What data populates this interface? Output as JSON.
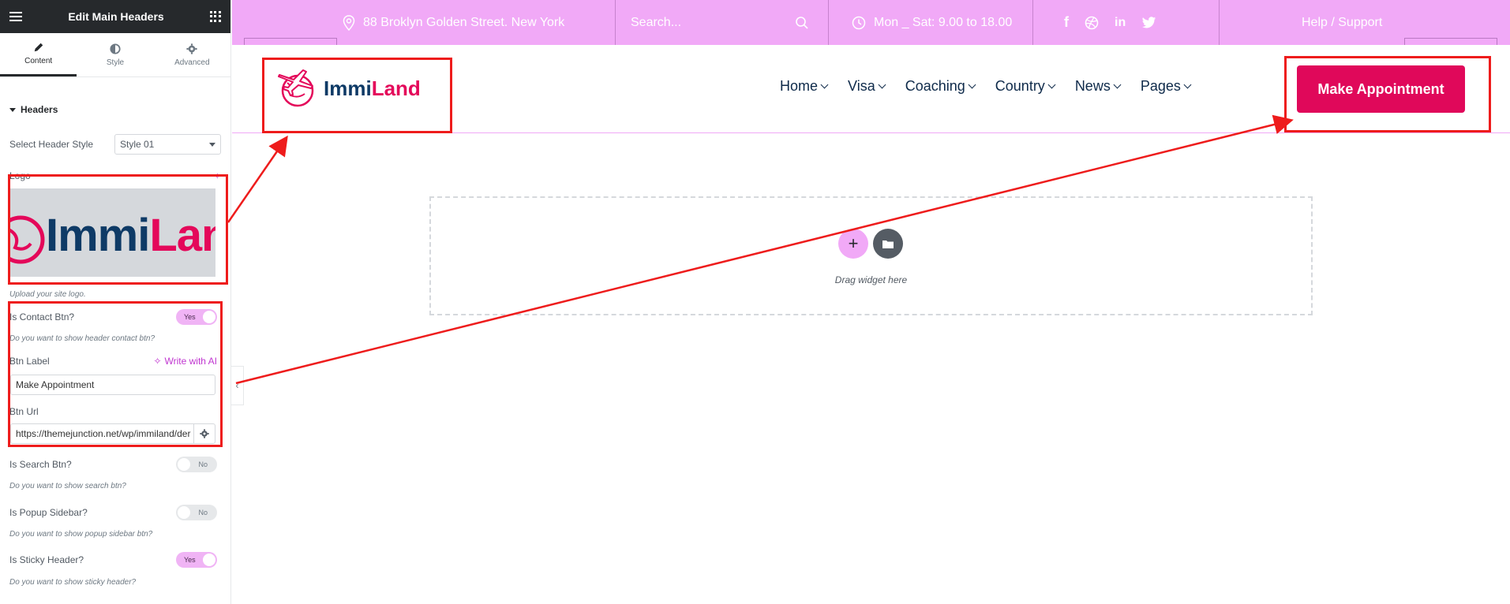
{
  "panel": {
    "title": "Edit Main Headers",
    "tabs": [
      {
        "label": "Content",
        "icon": "pencil-icon"
      },
      {
        "label": "Style",
        "icon": "contrast-icon"
      },
      {
        "label": "Advanced",
        "icon": "gear-icon"
      }
    ],
    "section_title": "Headers",
    "header_style": {
      "label": "Select Header Style",
      "value": "Style 01"
    },
    "logo": {
      "label": "Logo",
      "image_text_dark": "Immi",
      "image_text_red": "Lan",
      "help": "Upload your site logo."
    },
    "contact_btn": {
      "label": "Is Contact Btn?",
      "state": "Yes",
      "help": "Do you want to show header contact btn?"
    },
    "btn_label": {
      "label": "Btn Label",
      "ai_link": "Write with AI",
      "value": "Make Appointment"
    },
    "btn_url": {
      "label": "Btn Url",
      "value": "https://themejunction.net/wp/immiland/der"
    },
    "search_btn": {
      "label": "Is Search Btn?",
      "state": "No",
      "help": "Do you want to show search btn?"
    },
    "popup_sidebar": {
      "label": "Is Popup Sidebar?",
      "state": "No",
      "help": "Do you want to show popup sidebar btn?"
    },
    "sticky_header": {
      "label": "Is Sticky Header?",
      "state": "Yes",
      "help": "Do you want to show sticky header?"
    }
  },
  "topbar": {
    "address": "88 Broklyn Golden Street. New York",
    "search_placeholder": "Search...",
    "hours": "Mon _ Sat: 9.00 to 18.00",
    "social": [
      "facebook-icon",
      "dribbble-icon",
      "linkedin-icon",
      "twitter-icon"
    ],
    "help": "Help / Support"
  },
  "navbar": {
    "brand_dark": "Immi",
    "brand_red": "Land",
    "menu": [
      "Home",
      "Visa",
      "Coaching",
      "Country",
      "News",
      "Pages"
    ],
    "cta": "Make Appointment"
  },
  "dropzone": {
    "text": "Drag widget here",
    "add": "+"
  },
  "colors": {
    "accent": "#e0085a",
    "topbar": "#f1a9f7",
    "annotation": "#ee1c1c",
    "navy": "#0e3a66"
  }
}
